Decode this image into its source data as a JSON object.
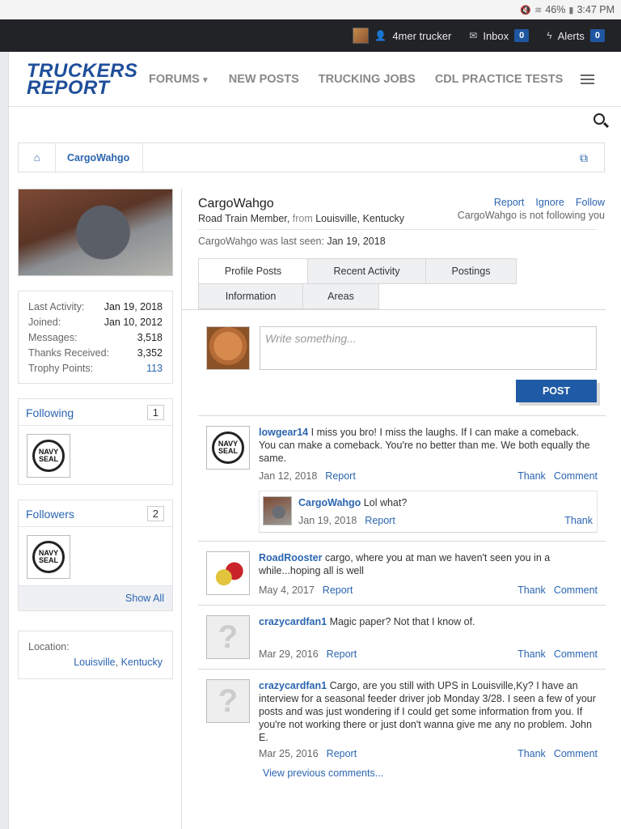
{
  "statusbar": {
    "battery": "46%",
    "time": "3:47 PM"
  },
  "topbar": {
    "username": "4mer trucker",
    "inbox_label": "Inbox",
    "inbox_count": "0",
    "alerts_label": "Alerts",
    "alerts_count": "0"
  },
  "header": {
    "logo_line1": "TRUCKERS",
    "logo_line2": "REPORT",
    "nav": [
      "FORUMS",
      "NEW POSTS",
      "TRUCKING JOBS",
      "CDL PRACTICE TESTS"
    ]
  },
  "breadcrumb": {
    "current": "CargoWahgo"
  },
  "sidebar": {
    "stats": [
      {
        "label": "Last Activity:",
        "value": "Jan 19, 2018"
      },
      {
        "label": "Joined:",
        "value": "Jan 10, 2012"
      },
      {
        "label": "Messages:",
        "value": "3,518"
      },
      {
        "label": "Thanks Received:",
        "value": "3,352"
      },
      {
        "label": "Trophy Points:",
        "value": "113"
      }
    ],
    "following": {
      "title": "Following",
      "count": "1"
    },
    "followers": {
      "title": "Followers",
      "count": "2",
      "show_all": "Show All"
    },
    "seal_text": "NAVY SEAL",
    "location": {
      "label": "Location:",
      "city": "Louisville",
      "state": "Kentucky"
    }
  },
  "member": {
    "name": "CargoWahgo",
    "title": "Road Train Member",
    "from_word": "from",
    "location": "Louisville, Kentucky",
    "actions": [
      "Report",
      "Ignore",
      "Follow"
    ],
    "follow_note": "CargoWahgo is not following you",
    "last_seen_label": "CargoWahgo was last seen:",
    "last_seen": "Jan 19, 2018"
  },
  "tabs": [
    "Profile Posts",
    "Recent Activity",
    "Postings",
    "Information",
    "Areas"
  ],
  "composer": {
    "placeholder": "Write something...",
    "post_label": "POST"
  },
  "posts": [
    {
      "user": "lowgear14",
      "text": "I miss you bro! I miss the laughs. If I can make a comeback. You can make a comeback. You're no better than me. We both equally the same.",
      "date": "Jan 12, 2018",
      "report": "Report",
      "thank": "Thank",
      "comment": "Comment",
      "reply": {
        "user": "CargoWahgo",
        "text": "Lol what?",
        "date": "Jan 19, 2018",
        "report": "Report",
        "thank": "Thank"
      }
    },
    {
      "user": "RoadRooster",
      "text": "cargo, where you at man we haven't seen you in a while...hoping all is well",
      "date": "May 4, 2017",
      "report": "Report",
      "thank": "Thank",
      "comment": "Comment"
    },
    {
      "user": "crazycardfan1",
      "text": "Magic paper? Not that I know of.",
      "date": "Mar 29, 2016",
      "report": "Report",
      "thank": "Thank",
      "comment": "Comment"
    },
    {
      "user": "crazycardfan1",
      "text": "Cargo, are you still with UPS in Louisville,Ky? I have an interview for a seasonal feeder driver job Monday 3/28. I seen a few of your posts and was just wondering if I could get some information from you. If you're not working there or just don't wanna give me any no problem. John E.",
      "date": "Mar 25, 2016",
      "report": "Report",
      "thank": "Thank",
      "comment": "Comment"
    }
  ],
  "view_previous": "View previous comments..."
}
